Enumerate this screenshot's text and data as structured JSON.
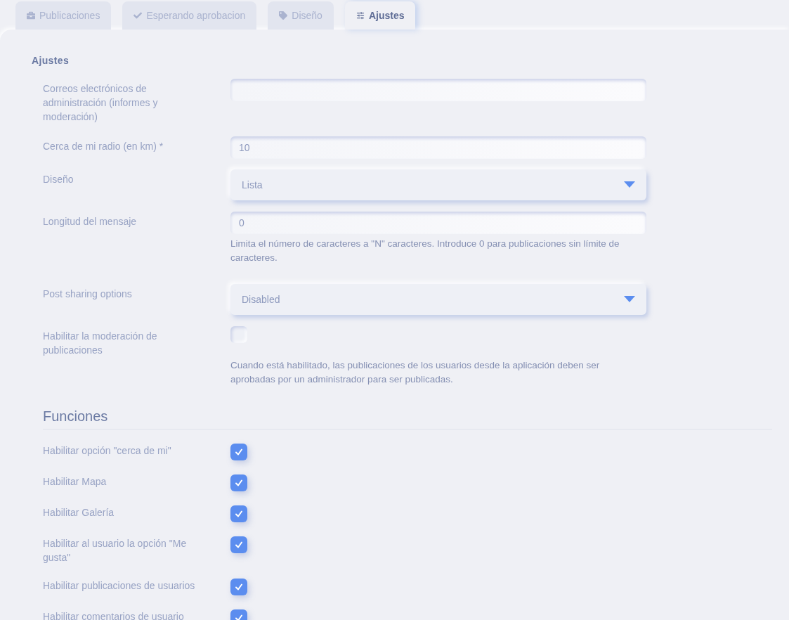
{
  "tabs": [
    {
      "label": "Publicaciones",
      "kind": "briefcase",
      "selected": false
    },
    {
      "label": "Esperando aprobacion",
      "kind": "check",
      "selected": false
    },
    {
      "label": "Diseño",
      "kind": "tag",
      "selected": false
    },
    {
      "label": "Ajustes",
      "kind": "sliders",
      "selected": true
    }
  ],
  "section_title": "Ajustes",
  "settings": [
    {
      "kind": "text",
      "label": "Correos electrónicos de administración (informes y moderación)"
    },
    {
      "kind": "text",
      "label": "Cerca de mi radio (en km) *",
      "value": "10"
    },
    {
      "kind": "select",
      "label": "Diseño",
      "value": "Lista"
    },
    {
      "kind": "text",
      "label": "Longitud del mensaje",
      "value": "0",
      "help": "Limita el número de caracteres a \"N\" caracteres. Introduce 0 para publicaciones sin límite de caracteres."
    },
    {
      "kind": "select",
      "label": "Post sharing options",
      "value": "Disabled"
    },
    {
      "kind": "checkbox",
      "label": "Habilitar la moderación de publicaciones",
      "checked": false,
      "help": "Cuando está habilitado, las publicaciones de los usuarios desde la aplicación deben ser aprobadas por un administrador para ser publicadas."
    }
  ],
  "functions_title": "Funciones",
  "functions": [
    {
      "label": "Habilitar opción \"cerca de mi\"",
      "checked": true
    },
    {
      "label": "Habilitar Mapa",
      "checked": true
    },
    {
      "label": "Habilitar Galería",
      "checked": true
    },
    {
      "label": "Habilitar al usuario la opción \"Me gusta\"",
      "checked": true
    },
    {
      "label": "Habilitar publicaciones de usuarios",
      "checked": true
    },
    {
      "label": "Habilitar comentarios de usuario",
      "checked": true
    }
  ]
}
